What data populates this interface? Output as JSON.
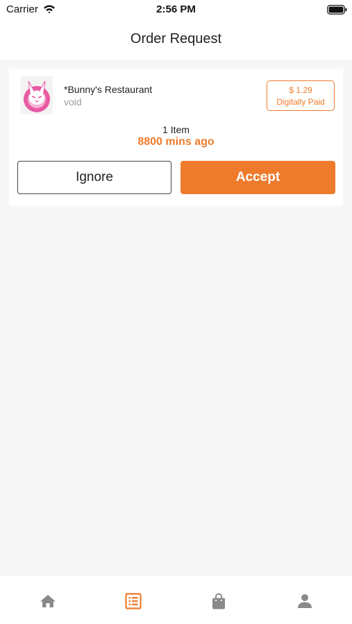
{
  "status_bar": {
    "carrier": "Carrier",
    "time": "2:56 PM",
    "wifi_icon": "wifi-icon",
    "battery_icon": "battery-icon"
  },
  "header": {
    "title": "Order Request"
  },
  "order": {
    "restaurant_name": "*Bunny's Restaurant",
    "restaurant_status": "void",
    "avatar_icon": "bunny-logo",
    "payment": {
      "amount": "$ 1.29",
      "method": "Digitally Paid"
    },
    "item_count": "1 Item",
    "time_ago": "8800 mins ago",
    "ignore_label": "Ignore",
    "accept_label": "Accept"
  },
  "tab_bar": {
    "items": [
      {
        "icon": "home-icon",
        "active": false
      },
      {
        "icon": "orders-list-icon",
        "active": true
      },
      {
        "icon": "shopping-bag-icon",
        "active": false
      },
      {
        "icon": "profile-icon",
        "active": false
      }
    ]
  },
  "colors": {
    "accent": "#ee7b2c",
    "inactive_icon": "#8a8a8a",
    "background": "#f7f7f7",
    "avatar_pink": "#e85aa4"
  }
}
